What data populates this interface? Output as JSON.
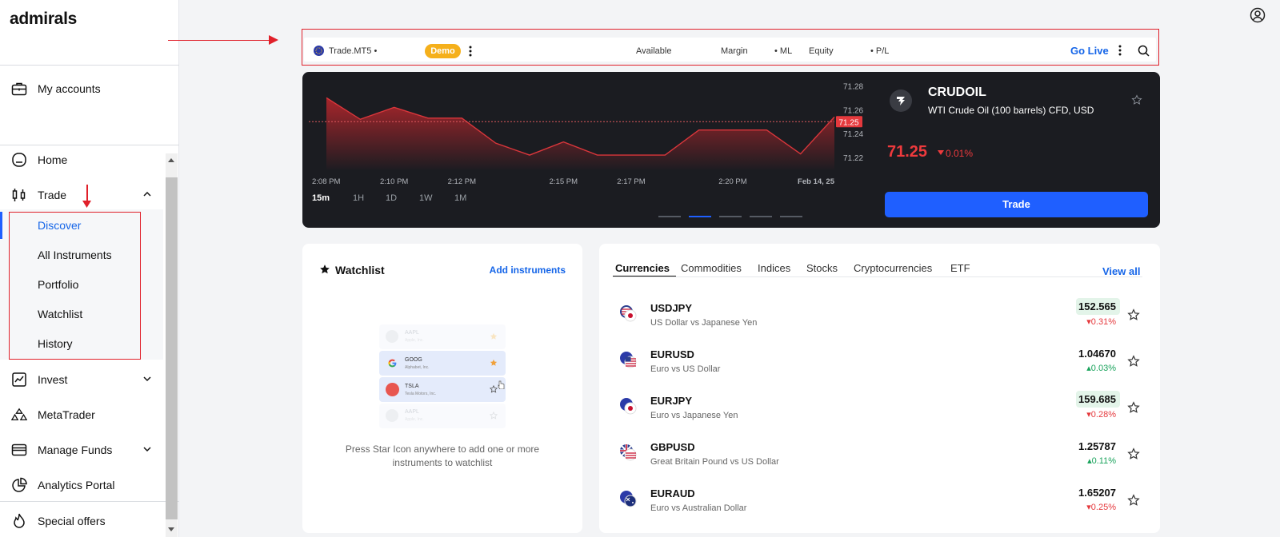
{
  "sidebar": {
    "logo": "admirals",
    "my_accounts": "My accounts",
    "home": "Home",
    "trade": "Trade",
    "sub_items": [
      "Discover",
      "All Instruments",
      "Portfolio",
      "Watchlist",
      "History"
    ],
    "invest": "Invest",
    "metatrader": "MetaTrader",
    "manage_funds": "Manage Funds",
    "analytics": "Analytics Portal",
    "special_offers": "Special offers"
  },
  "account_bar": {
    "account": "Trade.MT5 •",
    "badge": "Demo",
    "available": "Available",
    "margin": "Margin",
    "ml": "• ML",
    "equity": "Equity",
    "pl": "• P/L",
    "go_live": "Go Live"
  },
  "chart_data": {
    "type": "area",
    "title": "CRUDOIL",
    "x_labels": [
      "2:08 PM",
      "2:10 PM",
      "2:12 PM",
      "2:15 PM",
      "2:17 PM",
      "2:20 PM",
      "Feb 14, 25"
    ],
    "y_ticks": [
      "71.28",
      "71.26",
      "71.24",
      "71.22"
    ],
    "ylim": [
      71.21,
      71.285
    ],
    "values": [
      71.27,
      71.252,
      71.262,
      71.253,
      71.253,
      71.232,
      71.222,
      71.233,
      71.222,
      71.222,
      71.222,
      71.243,
      71.243,
      71.243,
      71.223,
      71.254
    ],
    "current_label": "71.25",
    "ranges": [
      "15m",
      "1H",
      "1D",
      "1W",
      "1M"
    ],
    "active_range": "15m"
  },
  "instrument": {
    "symbol": "CRUDOIL",
    "name": "WTI Crude Oil (100 barrels) CFD, USD",
    "price": "71.25",
    "change": "0.01%",
    "trade_button": "Trade"
  },
  "watchlist": {
    "title": "Watchlist",
    "add": "Add instruments",
    "preview": [
      {
        "ticker": "AAPL",
        "company": "Apple, Inc."
      },
      {
        "ticker": "GOOG",
        "company": "Alphabet, Inc."
      },
      {
        "ticker": "TSLA",
        "company": "Tesla Motors, Inc."
      },
      {
        "ticker": "AAPL",
        "company": "Apple, Inc."
      }
    ],
    "hint": "Press Star Icon anywhere to add one or more instruments to watchlist"
  },
  "markets": {
    "tabs": [
      "Currencies",
      "Commodities",
      "Indices",
      "Stocks",
      "Cryptocurrencies",
      "ETF"
    ],
    "view_all": "View all",
    "rows": [
      {
        "symbol": "USDJPY",
        "desc": "US Dollar vs Japanese Yen",
        "price": "152.565",
        "change": "0.31%",
        "dir": "down",
        "hl": true
      },
      {
        "symbol": "EURUSD",
        "desc": "Euro vs US Dollar",
        "price": "1.04670",
        "change": "0.03%",
        "dir": "up",
        "hl": false
      },
      {
        "symbol": "EURJPY",
        "desc": "Euro vs Japanese Yen",
        "price": "159.685",
        "change": "0.28%",
        "dir": "down",
        "hl": true
      },
      {
        "symbol": "GBPUSD",
        "desc": "Great Britain Pound vs US Dollar",
        "price": "1.25787",
        "change": "0.11%",
        "dir": "up",
        "hl": false
      },
      {
        "symbol": "EURAUD",
        "desc": "Euro vs Australian Dollar",
        "price": "1.65207",
        "change": "0.25%",
        "dir": "down",
        "hl": false
      }
    ]
  },
  "colors": {
    "accent": "#1f5fff",
    "red": "#e5393d",
    "green": "#1aa35c",
    "demo": "#f5b01b"
  }
}
